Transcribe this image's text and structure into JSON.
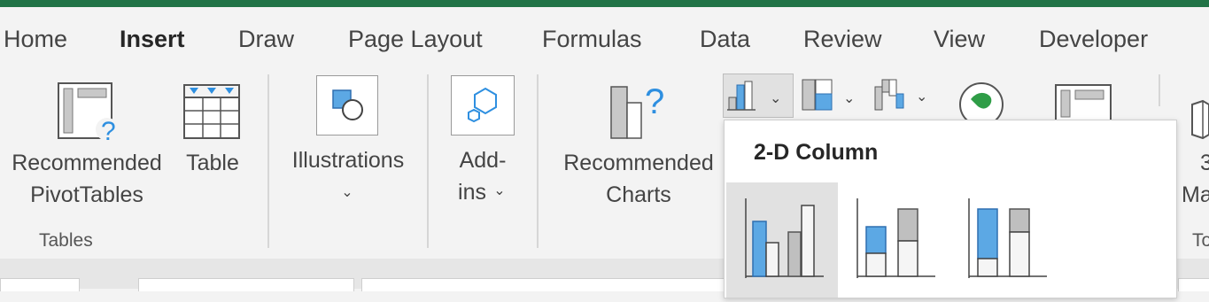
{
  "tabs": [
    "Home",
    "Insert",
    "Draw",
    "Page Layout",
    "Formulas",
    "Data",
    "Review",
    "View",
    "Developer"
  ],
  "active_tab": "Insert",
  "ribbon": {
    "recommended_pivottables": {
      "line1": "Recommended",
      "line2": "PivotTables"
    },
    "table": {
      "label": "Table"
    },
    "illustrations": {
      "label": "Illustrations"
    },
    "addins": {
      "line1": "Add-",
      "line2": "ins"
    },
    "recommended_charts": {
      "line1": "Recommended",
      "line2": "Charts"
    },
    "tables_group_label": "Tables",
    "clipped_right": {
      "line1": "3",
      "line2": "Ma",
      "group": "To"
    }
  },
  "dropdown": {
    "header": "2-D Column",
    "options": [
      "clustered-column",
      "stacked-column",
      "100-percent-stacked-column"
    ],
    "selected": "clustered-column"
  },
  "colors": {
    "accent": "#217346",
    "chart_blue": "#5ca8e4",
    "chart_gray": "#bfbfbf",
    "icon_blue": "#2e8fe0"
  },
  "chevron": "⌄"
}
